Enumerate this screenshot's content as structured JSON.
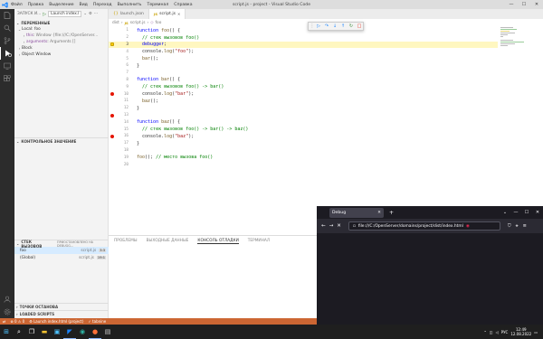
{
  "window": {
    "title": "script.js - project - Visual Studio Code",
    "menu": [
      "Файл",
      "Правка",
      "Выделение",
      "Вид",
      "Переход",
      "Выполнить",
      "Терминал",
      "Справка"
    ]
  },
  "sidebar": {
    "run_label": "ЗАПУСК И...",
    "launch_config": "Launch index.l",
    "variables_header": "ПЕРЕМЕННЫЕ",
    "local_scope": "Local: foo",
    "variables": [
      {
        "name": "this",
        "value": "Window {file:///C:/OpenServer..."
      },
      {
        "name": "arguments",
        "value": "Arguments []"
      }
    ],
    "block_scope": "Block",
    "global_scope": "Object Window",
    "watch_header": "КОНТРОЛЬНОЕ ЗНАЧЕНИЕ",
    "callstack_header": "СТЕК ВЫЗОВОВ",
    "callstack_status": "ПРИОСТАНОВЛЕНО НА DEBUGG...",
    "callstack": [
      {
        "fn": "foo",
        "file": "script.js",
        "line": "3:3"
      },
      {
        "fn": "(Global)",
        "file": "script.js",
        "line": "19:1"
      }
    ],
    "breakpoints_header": "ТОЧКИ ОСТАНОВА",
    "loaded_scripts_header": "LOADED SCRIPTS"
  },
  "tabs": [
    {
      "label": "launch.json",
      "type": "json",
      "active": false
    },
    {
      "label": "script.js",
      "type": "js",
      "active": true
    }
  ],
  "breadcrumbs": [
    "dist",
    "script.js",
    "foo"
  ],
  "editor": {
    "current_line": 3,
    "breakpoint_lines": [
      10,
      13,
      16
    ],
    "lines": [
      {
        "n": "1",
        "tokens": [
          {
            "t": "function",
            "c": "kw"
          },
          {
            "t": " "
          },
          {
            "t": "foo",
            "c": "fnn"
          },
          {
            "t": "() {"
          }
        ]
      },
      {
        "n": "2",
        "tokens": [
          {
            "t": "  // стек вызовов foo()",
            "c": "cmt"
          }
        ]
      },
      {
        "n": "3",
        "tokens": [
          {
            "t": "  "
          },
          {
            "t": "debugger",
            "c": "kw"
          },
          {
            "t": ";"
          }
        ]
      },
      {
        "n": "4",
        "tokens": [
          {
            "t": "  console."
          },
          {
            "t": "log",
            "c": "fnn"
          },
          {
            "t": "("
          },
          {
            "t": "\"foo\"",
            "c": "str"
          },
          {
            "t": ");"
          }
        ]
      },
      {
        "n": "5",
        "tokens": [
          {
            "t": "  "
          },
          {
            "t": "bar",
            "c": "fnn"
          },
          {
            "t": "();"
          }
        ]
      },
      {
        "n": "6",
        "tokens": [
          {
            "t": "}"
          }
        ]
      },
      {
        "n": "7",
        "tokens": []
      },
      {
        "n": "8",
        "tokens": [
          {
            "t": "function",
            "c": "kw"
          },
          {
            "t": " "
          },
          {
            "t": "bar",
            "c": "fnn"
          },
          {
            "t": "() {"
          }
        ]
      },
      {
        "n": "9",
        "tokens": [
          {
            "t": "  // стек вызовов foo() -> bar()",
            "c": "cmt"
          }
        ]
      },
      {
        "n": "10",
        "tokens": [
          {
            "t": "  console."
          },
          {
            "t": "log",
            "c": "fnn"
          },
          {
            "t": "("
          },
          {
            "t": "\"bar\"",
            "c": "str"
          },
          {
            "t": ");"
          }
        ]
      },
      {
        "n": "11",
        "tokens": [
          {
            "t": "  "
          },
          {
            "t": "baz",
            "c": "fnn"
          },
          {
            "t": "();"
          }
        ]
      },
      {
        "n": "12",
        "tokens": [
          {
            "t": "}"
          }
        ]
      },
      {
        "n": "13",
        "tokens": []
      },
      {
        "n": "14",
        "tokens": [
          {
            "t": "function",
            "c": "kw"
          },
          {
            "t": " "
          },
          {
            "t": "baz",
            "c": "fnn"
          },
          {
            "t": "() {"
          }
        ]
      },
      {
        "n": "15",
        "tokens": [
          {
            "t": "  // стек вызовов foo() -> bar() -> baz()",
            "c": "cmt"
          }
        ]
      },
      {
        "n": "16",
        "tokens": [
          {
            "t": "  console."
          },
          {
            "t": "log",
            "c": "fnn"
          },
          {
            "t": "("
          },
          {
            "t": "\"baz\"",
            "c": "str"
          },
          {
            "t": ");"
          }
        ]
      },
      {
        "n": "17",
        "tokens": [
          {
            "t": "}"
          }
        ]
      },
      {
        "n": "18",
        "tokens": []
      },
      {
        "n": "19",
        "tokens": [
          {
            "t": "foo",
            "c": "fnn"
          },
          {
            "t": "(); "
          },
          {
            "t": "// место вызова foo()",
            "c": "cmt"
          }
        ]
      },
      {
        "n": "20",
        "tokens": []
      }
    ]
  },
  "panel": {
    "tabs": [
      "ПРОБЛЕМЫ",
      "ВЫХОДНЫЕ ДАННЫЕ",
      "КОНСОЛЬ ОТЛАДКИ",
      "ТЕРМИНАЛ"
    ],
    "active_tab": 2
  },
  "statusbar": {
    "errors": "⊗ 0 ⚠ 0",
    "launch": "Launch index.html (project)",
    "tabnine": "tabnine"
  },
  "browser": {
    "tab_title": "Debug",
    "url": "file:///C:/OpenServer/domains/project/dist/index.html"
  },
  "taskbar": {
    "lang": "РУС",
    "time": "12:49",
    "date": "12.08.2022"
  },
  "colors": {
    "statusbar_debug": "#cc6633",
    "breakpoint": "#e51400",
    "current_line_bg": "#fff7c0"
  }
}
